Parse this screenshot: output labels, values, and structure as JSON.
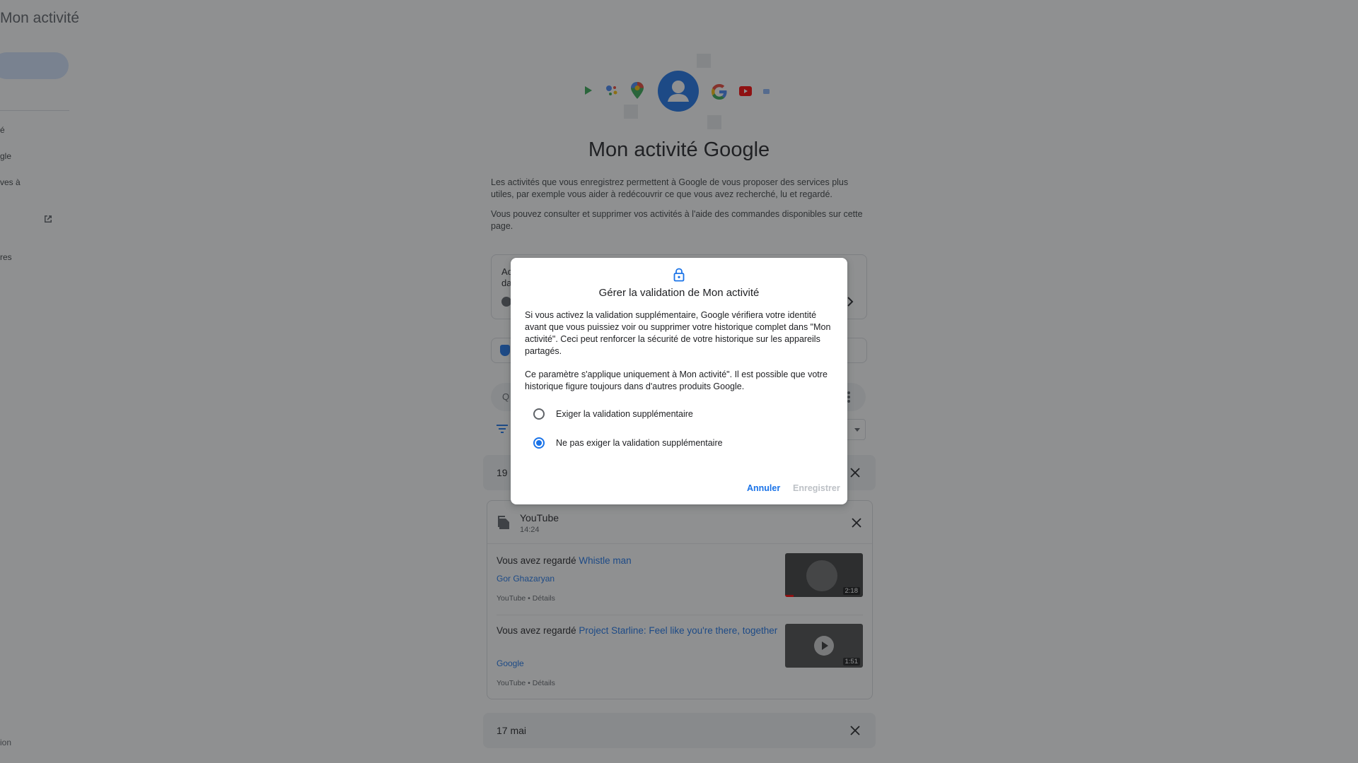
{
  "sidebar": {
    "title": "Mon activité",
    "items": [
      "é",
      "gle",
      "ves à",
      "res"
    ],
    "footer": "ion"
  },
  "page": {
    "title": "Mon activité Google",
    "intro1": "Les activités que vous enregistrez permettent à Google de vous proposer des services plus utiles, par exemple vous aider à redécouvrir ce que vous avez recherché, lu et regardé.",
    "intro2": "Vous pouvez consulter et supprimer vos activités à l'aide des commandes disponibles sur cette page.",
    "card_fragment_line1": "Ac",
    "card_fragment_line2": "da",
    "search_fragment": "Q"
  },
  "feed": {
    "day1": "19 r",
    "day2": "17 mai",
    "card": {
      "service": "YouTube",
      "time": "14:24",
      "items": [
        {
          "prefix": "Vous avez regardé ",
          "title": "Whistle man",
          "channel": "Gor Ghazaryan",
          "meta": "YouTube • Détails",
          "duration": "2:18"
        },
        {
          "prefix": "Vous avez regardé ",
          "title": "Project Starline: Feel like you're there, to­gether",
          "channel": "Google",
          "meta": "YouTube • Détails",
          "duration": "1:51"
        }
      ]
    }
  },
  "dialog": {
    "icon": "lock-icon",
    "title": "Gérer la validation de Mon activité",
    "para1": "Si vous activez la validation supplémentaire, Google vérifiera votre identité avant que vous puissiez voir ou supprimer votre historique complet dans \"Mon activité\". Ceci peut renforcer la sécurité de votre historique sur les appareils partagés.",
    "para2": "Ce paramètre s'applique uniquement à Mon activité\". Il est possible que votre historique figure toujours dans d'autres produits Google.",
    "options": [
      {
        "label": "Exiger la validation supplémentaire",
        "selected": false
      },
      {
        "label": "Ne pas exiger la validation supplémentaire",
        "selected": true
      }
    ],
    "cancel": "Annuler",
    "save": "Enregistrer"
  },
  "colors": {
    "accent": "#1a73e8",
    "scrim": "rgba(32,33,36,0.5)",
    "disabled": "#bdc1c6"
  }
}
